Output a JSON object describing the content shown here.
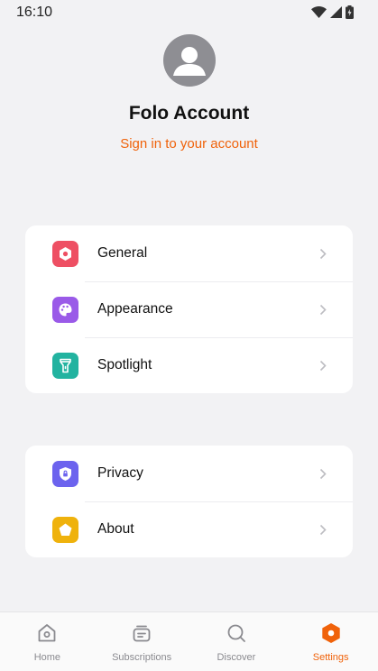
{
  "status_bar": {
    "time": "16:10"
  },
  "profile": {
    "title": "Folo Account",
    "signin_label": "Sign in to your account"
  },
  "settings_groups": [
    {
      "items": [
        {
          "label": "General",
          "icon": "general-icon",
          "color": "#ee4f63"
        },
        {
          "label": "Appearance",
          "icon": "palette-icon",
          "color": "#9a5ae8"
        },
        {
          "label": "Spotlight",
          "icon": "flashlight-icon",
          "color": "#22b3a0"
        }
      ]
    },
    {
      "items": [
        {
          "label": "Privacy",
          "icon": "shield-lock-icon",
          "color": "#6c63ee"
        },
        {
          "label": "About",
          "icon": "pentagon-icon",
          "color": "#efb20c"
        }
      ]
    }
  ],
  "tab_bar": {
    "active": "Settings",
    "accent_color": "#f0620a",
    "tabs": [
      {
        "label": "Home",
        "icon": "home-icon"
      },
      {
        "label": "Subscriptions",
        "icon": "subscriptions-icon"
      },
      {
        "label": "Discover",
        "icon": "search-icon"
      },
      {
        "label": "Settings",
        "icon": "settings-icon"
      }
    ]
  }
}
